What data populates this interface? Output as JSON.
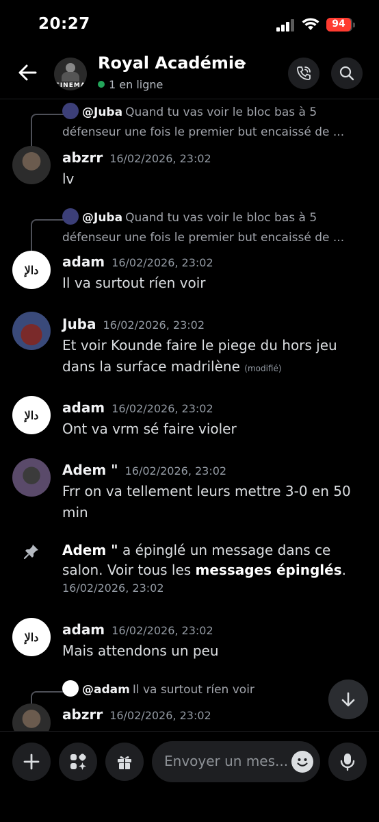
{
  "status_bar": {
    "time": "20:27",
    "battery": "94"
  },
  "header": {
    "title": "Royal Académie",
    "server_avatar_text": "CINEMA",
    "online": "1 en ligne"
  },
  "messages": [
    {
      "reply_to": {
        "name": "@Juba",
        "text": "Quand tu vas voir le bloc bas à 5 défenseur une fois le premier but encaissé de ..."
      },
      "author": "abzrr",
      "timestamp": "16/02/2026, 23:02",
      "text": "lv"
    },
    {
      "reply_to": {
        "name": "@Juba",
        "text": "Quand tu vas voir le bloc bas à 5 défenseur une fois le premier but encaissé de ..."
      },
      "author": "adam",
      "timestamp": "16/02/2026, 23:02",
      "text": "Il va surtout ríen voir"
    },
    {
      "author": "Juba",
      "timestamp": "16/02/2026, 23:02",
      "text": "Et voir Kounde faire le piege du hors jeu dans la surface madrilène",
      "edited": "(modifié)"
    },
    {
      "author": "adam",
      "timestamp": "16/02/2026, 23:02",
      "text": "Ont va vrm sé faire violer"
    },
    {
      "author": "Adem \"",
      "timestamp": "16/02/2026, 23:02",
      "text": "Frr on va tellement leurs mettre 3-0 en 50 min"
    },
    {
      "system": true,
      "actor": "Adem \"",
      "text_before": " a épinglé un message dans ce salon. Voir tous les ",
      "link": "messages épinglés",
      "text_after": ".",
      "timestamp": "16/02/2026, 23:02"
    },
    {
      "author": "adam",
      "timestamp": "16/02/2026, 23:02",
      "text": "Mais attendons un peu"
    },
    {
      "reply_to": {
        "name": "@adam",
        "text": "Il va surtout ríen voir"
      },
      "author": "abzrr",
      "timestamp": "16/02/2026, 23:02",
      "text": ""
    }
  ],
  "composer": {
    "placeholder": "Envoyer un mes..."
  },
  "colors": {
    "background": "#000000",
    "online": "#23a55a",
    "battery": "#ff3b30"
  }
}
